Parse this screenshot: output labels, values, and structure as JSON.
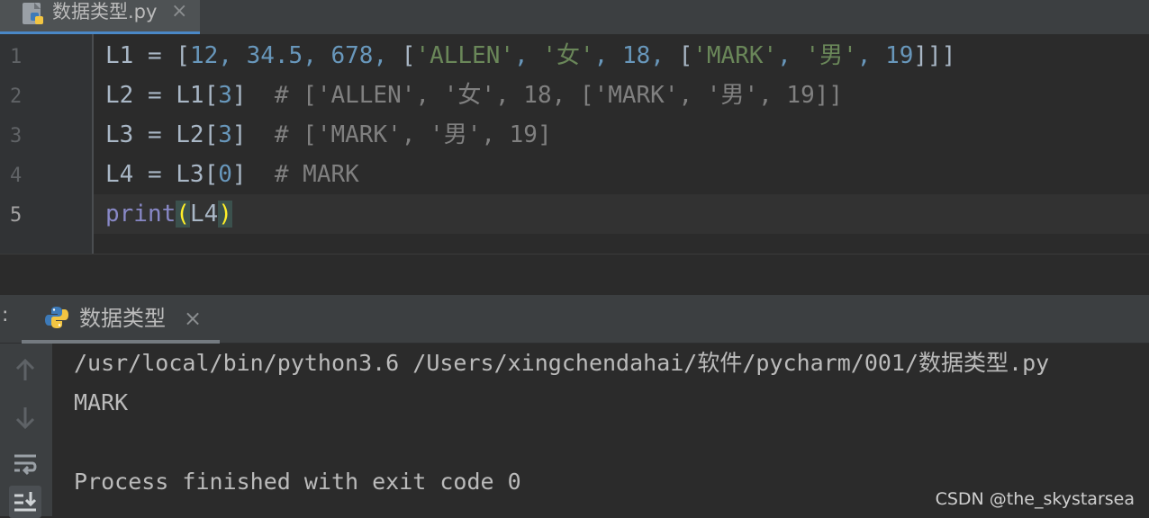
{
  "editor_tab": {
    "filename": "数据类型.py",
    "close": "×"
  },
  "gutter": {
    "lines": [
      "1",
      "2",
      "3",
      "4",
      "5"
    ]
  },
  "code": {
    "line1": {
      "var": "L1 = ",
      "b1": "[",
      "n1": "12",
      "s1": ", ",
      "n2": "34.5",
      "s2": ", ",
      "n3": "678",
      "s3": ", ",
      "b2": "[",
      "str1": "'ALLEN'",
      "s4": ", ",
      "str2": "'女'",
      "s5": ", ",
      "n4": "18",
      "s6": ", ",
      "b3": "[",
      "str3": "'MARK'",
      "s7": ", ",
      "str4": "'男'",
      "s8": ", ",
      "n5": "19",
      "b4": "]]]"
    },
    "line2": {
      "var": "L2 = L1[",
      "idx": "3",
      "close": "]",
      "comment": "  # ['ALLEN', '女', 18, ['MARK', '男', 19]]"
    },
    "line3": {
      "var": "L3 = L2[",
      "idx": "3",
      "close": "]",
      "comment": "  # ['MARK', '男', 19]"
    },
    "line4": {
      "var": "L4 = L3[",
      "idx": "0",
      "close": "]",
      "comment": "  # MARK"
    },
    "line5": {
      "fn": "print",
      "open": "(",
      "arg": "L4",
      "close": ")"
    }
  },
  "run_panel": {
    "prefix": ":",
    "tab_label": "数据类型",
    "close": "×",
    "output": [
      "/usr/local/bin/python3.6 /Users/xingchendahai/软件/pycharm/001/数据类型.py",
      "MARK",
      "",
      "Process finished with exit code 0"
    ],
    "side_icons": [
      "arrow-up-icon",
      "arrow-down-icon",
      "soft-wrap-icon",
      "scroll-to-end-icon"
    ]
  },
  "watermark": "CSDN @the_skystarsea",
  "colors": {
    "background": "#2b2b2b",
    "number": "#6897bb",
    "string": "#6a8759",
    "comment": "#808080",
    "builtin": "#8888c6",
    "brace_highlight": "#ffef28"
  }
}
